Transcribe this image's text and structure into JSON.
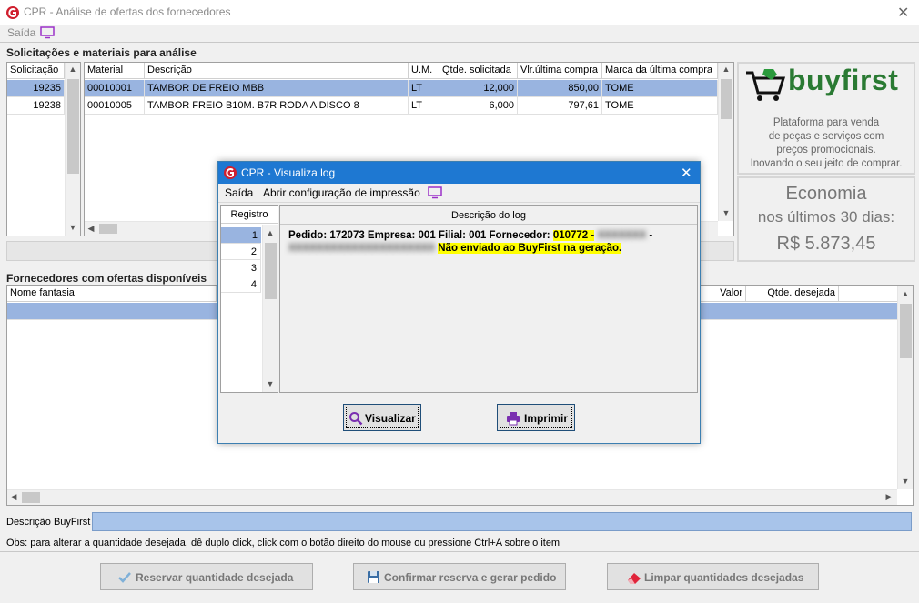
{
  "window": {
    "title": "CPR - Análise de ofertas dos fornecedores",
    "close": "✕"
  },
  "menu": {
    "exit": "Saída"
  },
  "top_section": {
    "title": "Solicitações e materiais para análise",
    "requests": {
      "header": "Solicitação",
      "rows": [
        "19235",
        "19238"
      ]
    },
    "materials": {
      "headers": [
        "Material",
        "Descrição",
        "U.M.",
        "Qtde. solicitada",
        "Vlr.última compra",
        "Marca da última compra"
      ],
      "rows": [
        [
          "00010001",
          "TAMBOR DE FREIO MBB",
          "LT",
          "12,000",
          "850,00",
          "TOME"
        ],
        [
          "00010005",
          "TAMBOR FREIO B10M. B7R RODA A DISCO 8",
          "LT",
          "6,000",
          "797,61",
          "TOME"
        ]
      ]
    }
  },
  "buyfirst": {
    "logo_text": "buyfirst",
    "tagline": [
      "Plataforma para venda",
      "de peças e serviços com",
      "preços promocionais.",
      "Inovando o seu jeito de comprar."
    ],
    "savings_title": "Economia",
    "savings_period": "nos últimos 30 dias:",
    "savings_value": "R$  5.873,45"
  },
  "suppliers_section": {
    "title": "Fornecedores com ofertas disponíveis",
    "headers": {
      "name": "Nome fantasia",
      "value": "Valor",
      "qty": "Qtde. desejada"
    }
  },
  "description_label": "Descrição BuyFirst",
  "obs": "Obs: para alterar a quantidade desejada, dê duplo click, click com o botão direito do mouse ou pressione Ctrl+A sobre o item",
  "buttons": {
    "reserve": "Reservar quantidade desejada",
    "confirm": "Confirmar reserva e gerar pedido",
    "clear": "Limpar quantidades desejadas"
  },
  "dialog": {
    "title": "CPR - Visualiza log",
    "menu_exit": "Saída",
    "menu_print_config": "Abrir configuração de impressão",
    "col_record": "Registro",
    "col_desc": "Descrição do log",
    "records": [
      "1",
      "2",
      "3",
      "4"
    ],
    "log_line1": "Pedido: 172073 Empresa: 001 Filial: 001 Fornecedor: ",
    "supplier_code": "010772 -",
    "supplier_name_blur": "XXXXXXX",
    "dash": "-",
    "blur_line2": "XXXXXXXXXXXXXXXXXXXXX",
    "log_line2": "Não enviado ao BuyFirst na geração.",
    "btn_view": "Visualizar",
    "btn_print": "Imprimir"
  },
  "colors": {
    "accent": "#1e78d2",
    "brand_green": "#2a7a33",
    "selection": "#99b4e0",
    "highlight": "#ffff00"
  }
}
